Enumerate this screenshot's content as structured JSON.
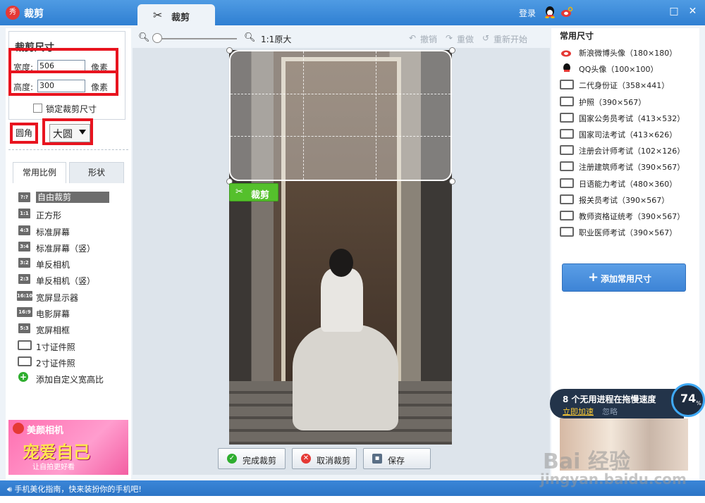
{
  "app": {
    "title": "裁剪",
    "tab_label": "裁剪",
    "login": "登录",
    "window_controls": [
      "□",
      "✕"
    ]
  },
  "crop_size": {
    "title": "裁剪尺寸",
    "width_label": "宽度:",
    "width_value": "506",
    "height_label": "高度:",
    "height_value": "300",
    "unit": "像素",
    "lock_label": "锁定裁剪尺寸",
    "round_label": "圆角",
    "round_value": "大圆"
  },
  "ratio_tabs": [
    "常用比例",
    "形状"
  ],
  "ratios": [
    {
      "badge": "?:?",
      "label": "自由裁剪",
      "selected": true
    },
    {
      "badge": "1:1",
      "label": "正方形"
    },
    {
      "badge": "4:3",
      "label": "标准屏幕"
    },
    {
      "badge": "3:4",
      "label": "标准屏幕（竖）"
    },
    {
      "badge": "3:2",
      "label": "单反相机"
    },
    {
      "badge": "2:3",
      "label": "单反相机（竖）"
    },
    {
      "badge": "16:10",
      "label": "宽屏显示器"
    },
    {
      "badge": "16:9",
      "label": "电影屏幕"
    },
    {
      "badge": "5:3",
      "label": "宽屏相框"
    },
    {
      "badge": "",
      "label": "1寸证件照"
    },
    {
      "badge": "",
      "label": "2寸证件照"
    },
    {
      "badge": "+",
      "label": "添加自定义宽高比"
    }
  ],
  "ad": {
    "title": "美颜相机",
    "slogan": "宠爱自己",
    "sub": "让自拍更好看"
  },
  "toolbar": {
    "orig_size": "1:1原大",
    "undo": "撤销",
    "redo": "重做",
    "restart": "重新开始"
  },
  "crop_apply": "裁剪",
  "bottom_buttons": {
    "finish": "完成裁剪",
    "cancel": "取消裁剪",
    "save": "保存"
  },
  "presets_title": "常用尺寸",
  "presets": [
    {
      "icon": "weibo-icon",
      "label": "新浪微博头像（180×180）"
    },
    {
      "icon": "qq-icon",
      "label": "QQ头像（100×100）"
    },
    {
      "icon": "idcard-icon",
      "label": "二代身份证（358×441）"
    },
    {
      "icon": "idcard-icon",
      "label": "护照（390×567）"
    },
    {
      "icon": "idcard-icon",
      "label": "国家公务员考试（413×532）"
    },
    {
      "icon": "idcard-icon",
      "label": "国家司法考试（413×626）"
    },
    {
      "icon": "idcard-icon",
      "label": "注册会计师考试（102×126）"
    },
    {
      "icon": "idcard-icon",
      "label": "注册建筑师考试（390×567）"
    },
    {
      "icon": "idcard-icon",
      "label": "日语能力考试（480×360）"
    },
    {
      "icon": "idcard-icon",
      "label": "报关员考试（390×567）"
    },
    {
      "icon": "idcard-icon",
      "label": "教师资格证统考（390×567）"
    },
    {
      "icon": "idcard-icon",
      "label": "职业医师考试（390×567）"
    }
  ],
  "add_common": "添加常用尺寸",
  "popup": {
    "message": "8 个无用进程在拖慢速度",
    "accelerate": "立即加速",
    "ignore": "忽略",
    "percent": "74",
    "percent_unit": "%"
  },
  "status": "手机美化指南，快来装扮你的手机吧!",
  "watermark": {
    "line1": "Bai 经验",
    "line2": "jingyan.baidu.com"
  },
  "colors": {
    "accent": "#2f7fd2",
    "highlight": "#e8141f",
    "apply": "#55c02c"
  }
}
